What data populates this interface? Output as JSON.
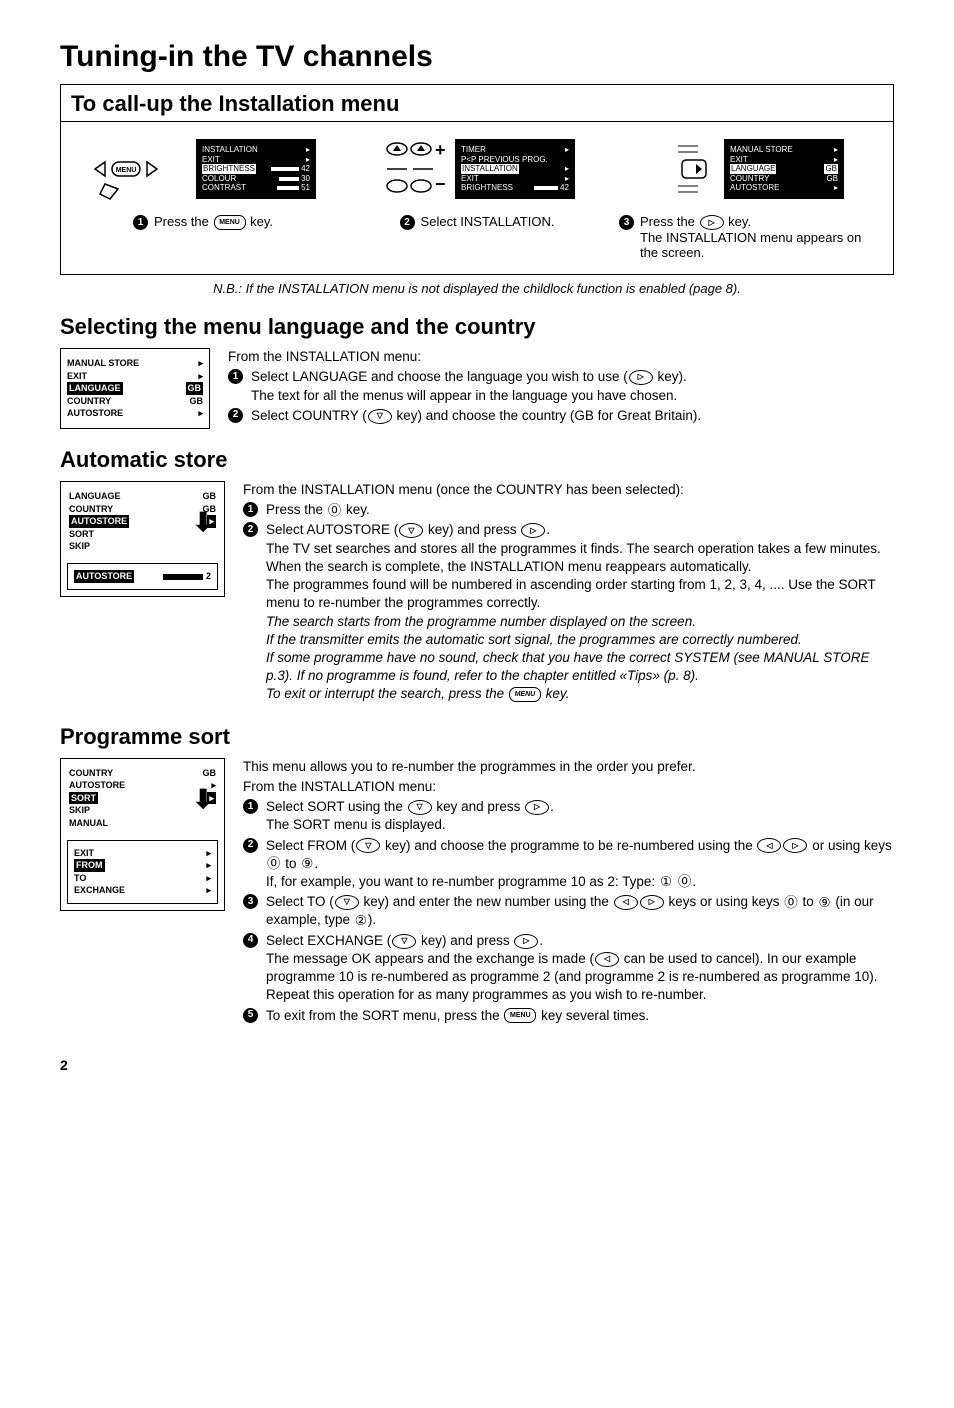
{
  "page_title": "Tuning-in the TV channels",
  "page_number": "2",
  "callup": {
    "heading": "To call-up the Installation menu",
    "screen1": {
      "l1": {
        "label": "INSTALLATION",
        "val": "▸"
      },
      "l2": {
        "label": "EXIT",
        "val": "▸"
      },
      "l3": {
        "label": "BRIGHTNESS",
        "val": "42",
        "hl": true
      },
      "l4": {
        "label": "COLOUR",
        "val": "30"
      },
      "l5": {
        "label": "CONTRAST",
        "val": "51"
      }
    },
    "screen2": {
      "l1": {
        "label": "TIMER",
        "val": "▸"
      },
      "l2": {
        "label": "P<P PREVIOUS PROG.",
        "val": ""
      },
      "l3": {
        "label": "INSTALLATION",
        "val": "▸",
        "hl": true
      },
      "l4": {
        "label": "EXIT",
        "val": "▸"
      },
      "l5": {
        "label": "BRIGHTNESS",
        "val": "42"
      }
    },
    "screen3": {
      "l1": {
        "label": "MANUAL STORE",
        "val": "▸"
      },
      "l2": {
        "label": "EXIT",
        "val": "▸"
      },
      "l3": {
        "label": "LANGUAGE",
        "val": "GB",
        "hl": true
      },
      "l4": {
        "label": "COUNTRY",
        "val": "GB"
      },
      "l5": {
        "label": "AUTOSTORE",
        "val": "▸"
      }
    },
    "step1_a": "Press the",
    "step1_b": "key.",
    "step2": "Select INSTALLATION.",
    "step3_a": "Press the",
    "step3_b": "key.",
    "step3_c": "The INSTALLATION menu appears on the screen.",
    "note": "N.B.: If the INSTALLATION menu is not displayed the childlock function is enabled (page 8)."
  },
  "lang": {
    "heading": "Selecting the menu language and the country",
    "screen": {
      "l1": {
        "label": "MANUAL STORE",
        "val": "▸"
      },
      "l2": {
        "label": "EXIT",
        "val": "▸"
      },
      "l3": {
        "label": "LANGUAGE",
        "val": "GB",
        "hl": true
      },
      "l4": {
        "label": "COUNTRY",
        "val": "GB"
      },
      "l5": {
        "label": "AUTOSTORE",
        "val": "▸"
      }
    },
    "intro": "From the INSTALLATION menu:",
    "s1a": "Select LANGUAGE and choose the language you wish to use (",
    "s1b": " key).",
    "s1c": "The text for all the menus will appear in the language you have chosen.",
    "s2a": "Select COUNTRY (",
    "s2b": " key) and choose the country (GB for Great Britain)."
  },
  "auto": {
    "heading": "Automatic store",
    "screen_upper": {
      "l1": {
        "label": "LANGUAGE",
        "val": "GB"
      },
      "l2": {
        "label": "COUNTRY",
        "val": "GB"
      },
      "l3": {
        "label": "AUTOSTORE",
        "val": "▸",
        "hl": true
      },
      "l4": {
        "label": "SORT",
        "val": ""
      },
      "l5": {
        "label": "SKIP",
        "val": ""
      }
    },
    "screen_lower": {
      "label": "AUTOSTORE",
      "val": "2",
      "hl": true
    },
    "intro": "From the INSTALLATION menu (once the COUNTRY has been selected):",
    "s1a": "Press the ",
    "s1b": " key.",
    "s2a": "Select AUTOSTORE (",
    "s2b": " key) and press ",
    "s2c": ".",
    "s2d": "The TV set searches and stores all the programmes it finds. The search operation takes a few minutes. When the search is complete, the INSTALLATION menu reappears automatically.",
    "s2e": "The programmes found will be numbered in ascending order starting from 1, 2, 3, 4, .... Use the SORT menu to re-number the programmes correctly.",
    "it1": "The search starts from the programme number displayed on the screen.",
    "it2": "If the transmitter emits the automatic sort signal, the programmes are correctly numbered.",
    "it3": "If some programme have no sound, check that you have the correct SYSTEM (see MANUAL STORE p.3). If no programme is found, refer to the chapter entitled «Tips» (p. 8).",
    "it4a": "To exit or interrupt the search, press the ",
    "it4b": " key."
  },
  "sort": {
    "heading": "Programme sort",
    "screen_upper": {
      "l1": {
        "label": "COUNTRY",
        "val": "GB"
      },
      "l2": {
        "label": "AUTOSTORE",
        "val": "▸"
      },
      "l3": {
        "label": "SORT",
        "val": "▸",
        "hl": true
      },
      "l4": {
        "label": "SKIP",
        "val": ""
      },
      "l5": {
        "label": "MANUAL",
        "val": ""
      }
    },
    "screen_lower": {
      "l1": {
        "label": "EXIT",
        "val": "▸"
      },
      "l2": {
        "label": "FROM",
        "val": "▸",
        "hl": true
      },
      "l3": {
        "label": "TO",
        "val": "▸"
      },
      "l4": {
        "label": "EXCHANGE",
        "val": "▸"
      }
    },
    "intro1": "This menu allows you to re-number the programmes in the order you prefer.",
    "intro2": "From the INSTALLATION menu:",
    "s1a": "Select SORT using the ",
    "s1b": " key and press ",
    "s1c": ".",
    "s1d": "The SORT menu is displayed.",
    "s2a": "Select FROM (",
    "s2b": " key) and choose the programme to be re-numbered using the ",
    "s2c": " or using keys ",
    "s2d": " to ",
    "s2e": ".",
    "s2f": "If, for example, you want to re-number programme 10 as 2: Type: ",
    "s2g": ".",
    "s3a": "Select TO (",
    "s3b": " key) and enter the new number using the ",
    "s3c": " keys or using keys ",
    "s3d": " to ",
    "s3e": " (in our example, type ",
    "s3f": ").",
    "s4a": "Select EXCHANGE (",
    "s4b": " key) and press ",
    "s4c": ".",
    "s4d": "The message OK appears and the exchange is made (",
    "s4e": " can be used to cancel). In our example programme 10 is re-numbered as programme 2 (and programme 2 is re-numbered as programme 10).",
    "s4f": "Repeat this operation for as many programmes as you wish to re-number.",
    "s5a": "To exit from the SORT menu, press the ",
    "s5b": " key several times."
  },
  "icons": {
    "menu": "MENU",
    "right": "▷",
    "left": "◁",
    "down": "▽",
    "leftright": "◁ ▷",
    "zero": "⓪",
    "one": "①",
    "two": "②",
    "nine": "⑨"
  }
}
